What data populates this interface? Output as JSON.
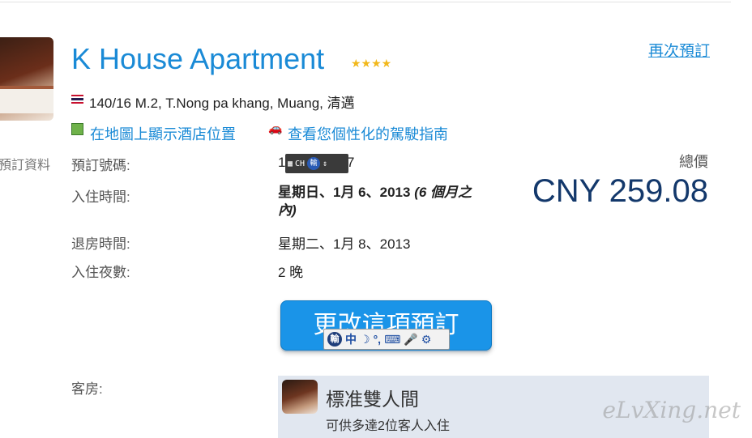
{
  "hotel": {
    "name": "K House Apartment",
    "stars": "★★★★",
    "address": "140/16 M.2, T.Nong pa khang, Muang, 清邁",
    "map_link": "在地圖上顯示酒店位置",
    "drive_link": "查看您個性化的駕駛指南",
    "rebook_link": "再次預訂"
  },
  "sidebar": {
    "label": "預訂資料"
  },
  "booking": {
    "number_label": "預訂號碼:",
    "number_partial_start": "1",
    "number_partial_end": "7",
    "checkin_label": "入住時間:",
    "checkin_date": "星期日、1月 6、2013",
    "checkin_note": "(6 個月之內)",
    "checkout_label": "退房時間:",
    "checkout_date": "星期二、1月 8、2013",
    "nights_label": "入住夜數:",
    "nights_value": "2 晚",
    "total_label": "總價",
    "total_price": "CNY 259.08",
    "change_button": "更改這項預訂"
  },
  "room": {
    "label": "客房:",
    "name": "標准雙人間",
    "capacity": "可供多達2位客人入住"
  },
  "ime": {
    "small_text": "CH",
    "logo": "輸",
    "bar_items": [
      "中",
      "☽",
      "°,",
      "⌨",
      "🎤",
      "⚙"
    ]
  },
  "watermark": "eLvXing.net",
  "colors": {
    "link": "#1a8ad6",
    "price": "#13386b",
    "button": "#1a94e8",
    "room_bg": "#e1e7f0"
  },
  "flag_country": "Thailand"
}
